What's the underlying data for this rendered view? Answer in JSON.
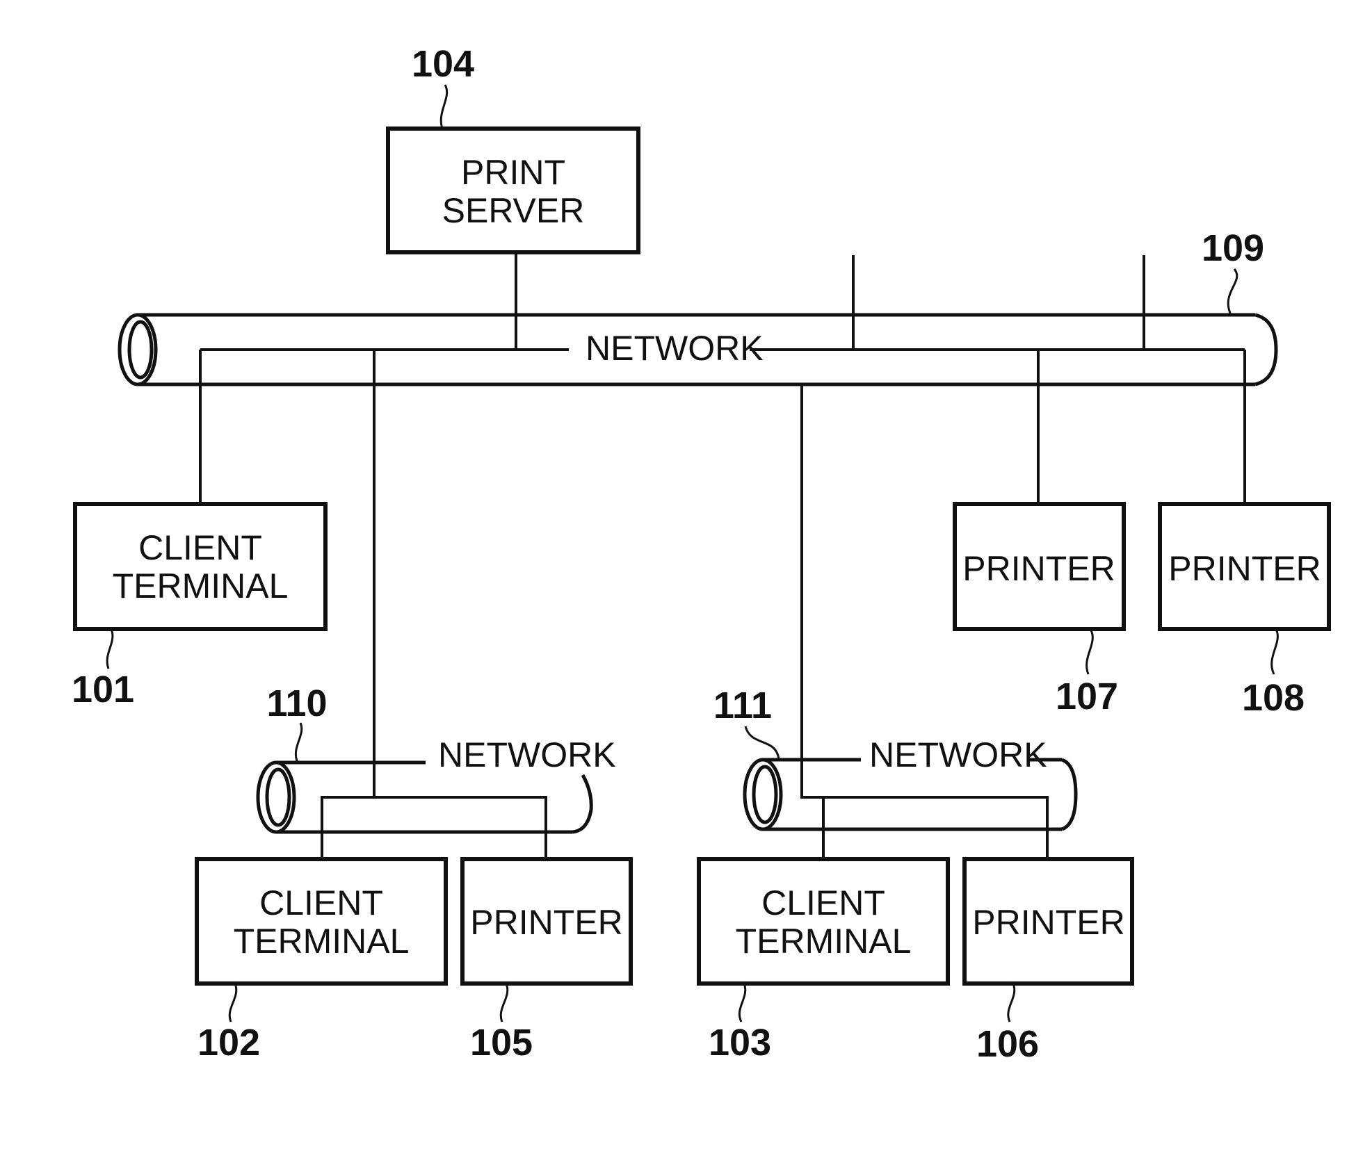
{
  "figure": {
    "type": "network-system-diagram",
    "nodes": {
      "print_server": {
        "ref": "104",
        "lines": [
          "PRINT",
          "SERVER"
        ]
      },
      "client_101": {
        "ref": "101",
        "lines": [
          "CLIENT",
          "TERMINAL"
        ]
      },
      "client_102": {
        "ref": "102",
        "lines": [
          "CLIENT",
          "TERMINAL"
        ]
      },
      "client_103": {
        "ref": "103",
        "lines": [
          "CLIENT",
          "TERMINAL"
        ]
      },
      "printer_105": {
        "ref": "105",
        "lines": [
          "PRINTER"
        ]
      },
      "printer_106": {
        "ref": "106",
        "lines": [
          "PRINTER"
        ]
      },
      "printer_107": {
        "ref": "107",
        "lines": [
          "PRINTER"
        ]
      },
      "printer_108": {
        "ref": "108",
        "lines": [
          "PRINTER"
        ]
      }
    },
    "networks": {
      "main": {
        "ref": "109",
        "label": "NETWORK"
      },
      "sub_110": {
        "ref": "110",
        "label": "NETWORK"
      },
      "sub_111": {
        "ref": "111",
        "label": "NETWORK"
      }
    },
    "connections": [
      [
        "109",
        "104"
      ],
      [
        "109",
        "101"
      ],
      [
        "109",
        "110"
      ],
      [
        "109",
        "111"
      ],
      [
        "109",
        "107"
      ],
      [
        "109",
        "108"
      ],
      [
        "110",
        "102"
      ],
      [
        "110",
        "105"
      ],
      [
        "111",
        "103"
      ],
      [
        "111",
        "106"
      ]
    ]
  }
}
